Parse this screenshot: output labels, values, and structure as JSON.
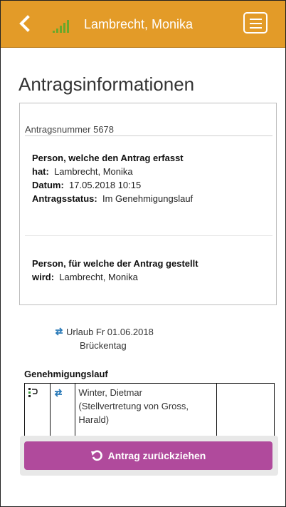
{
  "header": {
    "title": "Lambrecht, Monika",
    "bg_color": "#e39b28",
    "signal_color": "#6aa82b"
  },
  "page": {
    "title": "Antragsinformationen"
  },
  "card": {
    "antragsnummer": "Antragsnummer 5678",
    "erfasst_heading_line1": "Person, welche den Antrag erfasst",
    "erfasst_hat_label": "hat:",
    "erfasst_hat_value": "Lambrecht, Monika",
    "datum_label": "Datum:",
    "datum_value": "17.05.2018 10:15",
    "status_label": "Antragsstatus:",
    "status_value": "Im Genehmigungslauf",
    "gestellt_heading_line1": "Person, für welche der Antrag gestellt",
    "gestellt_wird_label": "wird:",
    "gestellt_wird_value": "Lambrecht, Monika"
  },
  "urlaub": {
    "line1": "Urlaub Fr 01.06.2018",
    "line2": "Brückentag"
  },
  "genehmigungslauf": {
    "label": "Genehmigungslauf",
    "rows": [
      {
        "approver_line1": "Winter, Dietmar",
        "approver_line2": "(Stellvertretung von Gross,",
        "approver_line3": "Harald)",
        "extra": ""
      }
    ]
  },
  "action": {
    "label": "Antrag zurückziehen",
    "color": "#b04a9c"
  },
  "icons": {
    "back": "chevron-left-icon",
    "signal": "signal-bars-icon",
    "menu": "hamburger-menu-icon",
    "swap": "swap-arrows-icon",
    "workflow": "workflow-icon",
    "undo": "undo-icon"
  }
}
